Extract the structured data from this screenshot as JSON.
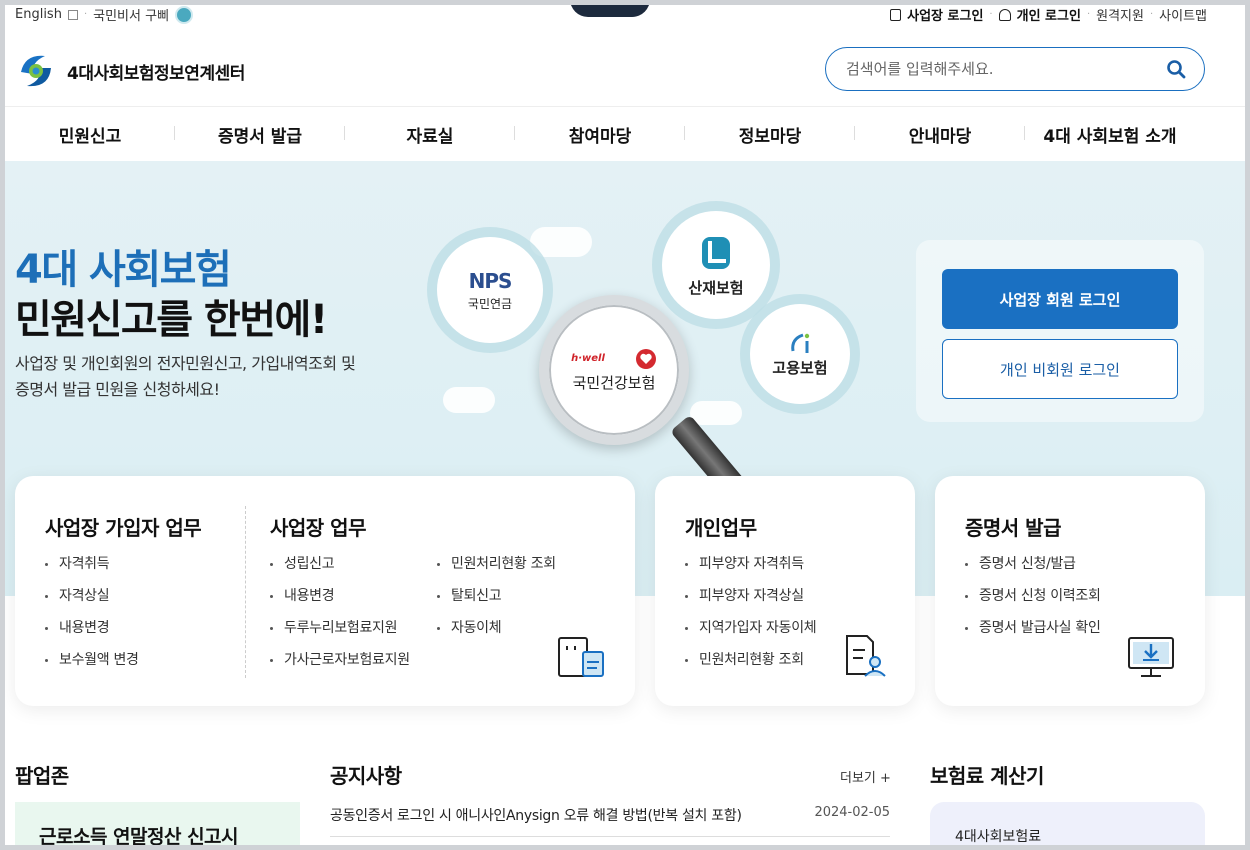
{
  "util": {
    "english": "English",
    "secretary": "국민비서 구삐",
    "biz_login": "사업장 로그인",
    "personal_login": "개인 로그인",
    "remote": "원격지원",
    "sitemap": "사이트맵"
  },
  "header": {
    "logo_text": "4대사회보험정보연계센터",
    "search_placeholder": "검색어를 입력해주세요."
  },
  "gnb": [
    "민원신고",
    "증명서 발급",
    "자료실",
    "참여마당",
    "정보마당",
    "안내마당",
    "4대 사회보험 소개"
  ],
  "hero": {
    "title1": "4대 사회보험",
    "title2": "민원신고를 한번에!",
    "desc1": "사업장 및 개인회원의 전자민원신고, 가입내역조회 및",
    "desc2": "증명서 발급 민원을 신청하세요!",
    "nps_logo": "NPS",
    "nps_label": "국민연금",
    "kcomwel_label": "산재보험",
    "ei_label": "고용보험",
    "nhis_brand": "h·well",
    "nhis_label": "국민건강보험",
    "biz_member_login": "사업장 회원 로그인",
    "personal_guest_login": "개인 비회원 로그인"
  },
  "cards": {
    "subscriber": {
      "title": "사업장 가입자 업무",
      "items": [
        "자격취득",
        "자격상실",
        "내용변경",
        "보수월액 변경"
      ]
    },
    "business": {
      "title": "사업장 업무",
      "col1": [
        "성립신고",
        "내용변경",
        "두루누리보험료지원",
        "가사근로자보험료지원"
      ],
      "col2": [
        "민원처리현황 조회",
        "탈퇴신고",
        "자동이체"
      ]
    },
    "personal": {
      "title": "개인업무",
      "items": [
        "피부양자 자격취득",
        "피부양자 자격상실",
        "지역가입자 자동이체",
        "민원처리현황 조회"
      ]
    },
    "certificate": {
      "title": "증명서 발급",
      "items": [
        "증명서 신청/발급",
        "증명서 신청 이력조회",
        "증명서 발급사실 확인"
      ]
    }
  },
  "bottom": {
    "popup_title": "팝업존",
    "popup_text": "근로소득 연말정산 신고시",
    "notice_title": "공지사항",
    "more": "더보기 +",
    "notice_item": "공동인증서 로그인 시 애니사인Anysign 오류 해결 방법(반복 설치 포함)",
    "notice_date": "2024-02-05",
    "calc_title": "보험료 계산기",
    "calc_item": "4대사회보험료"
  },
  "colors": {
    "brand_blue": "#1a70c2",
    "hero_bg": "#daeef3"
  }
}
